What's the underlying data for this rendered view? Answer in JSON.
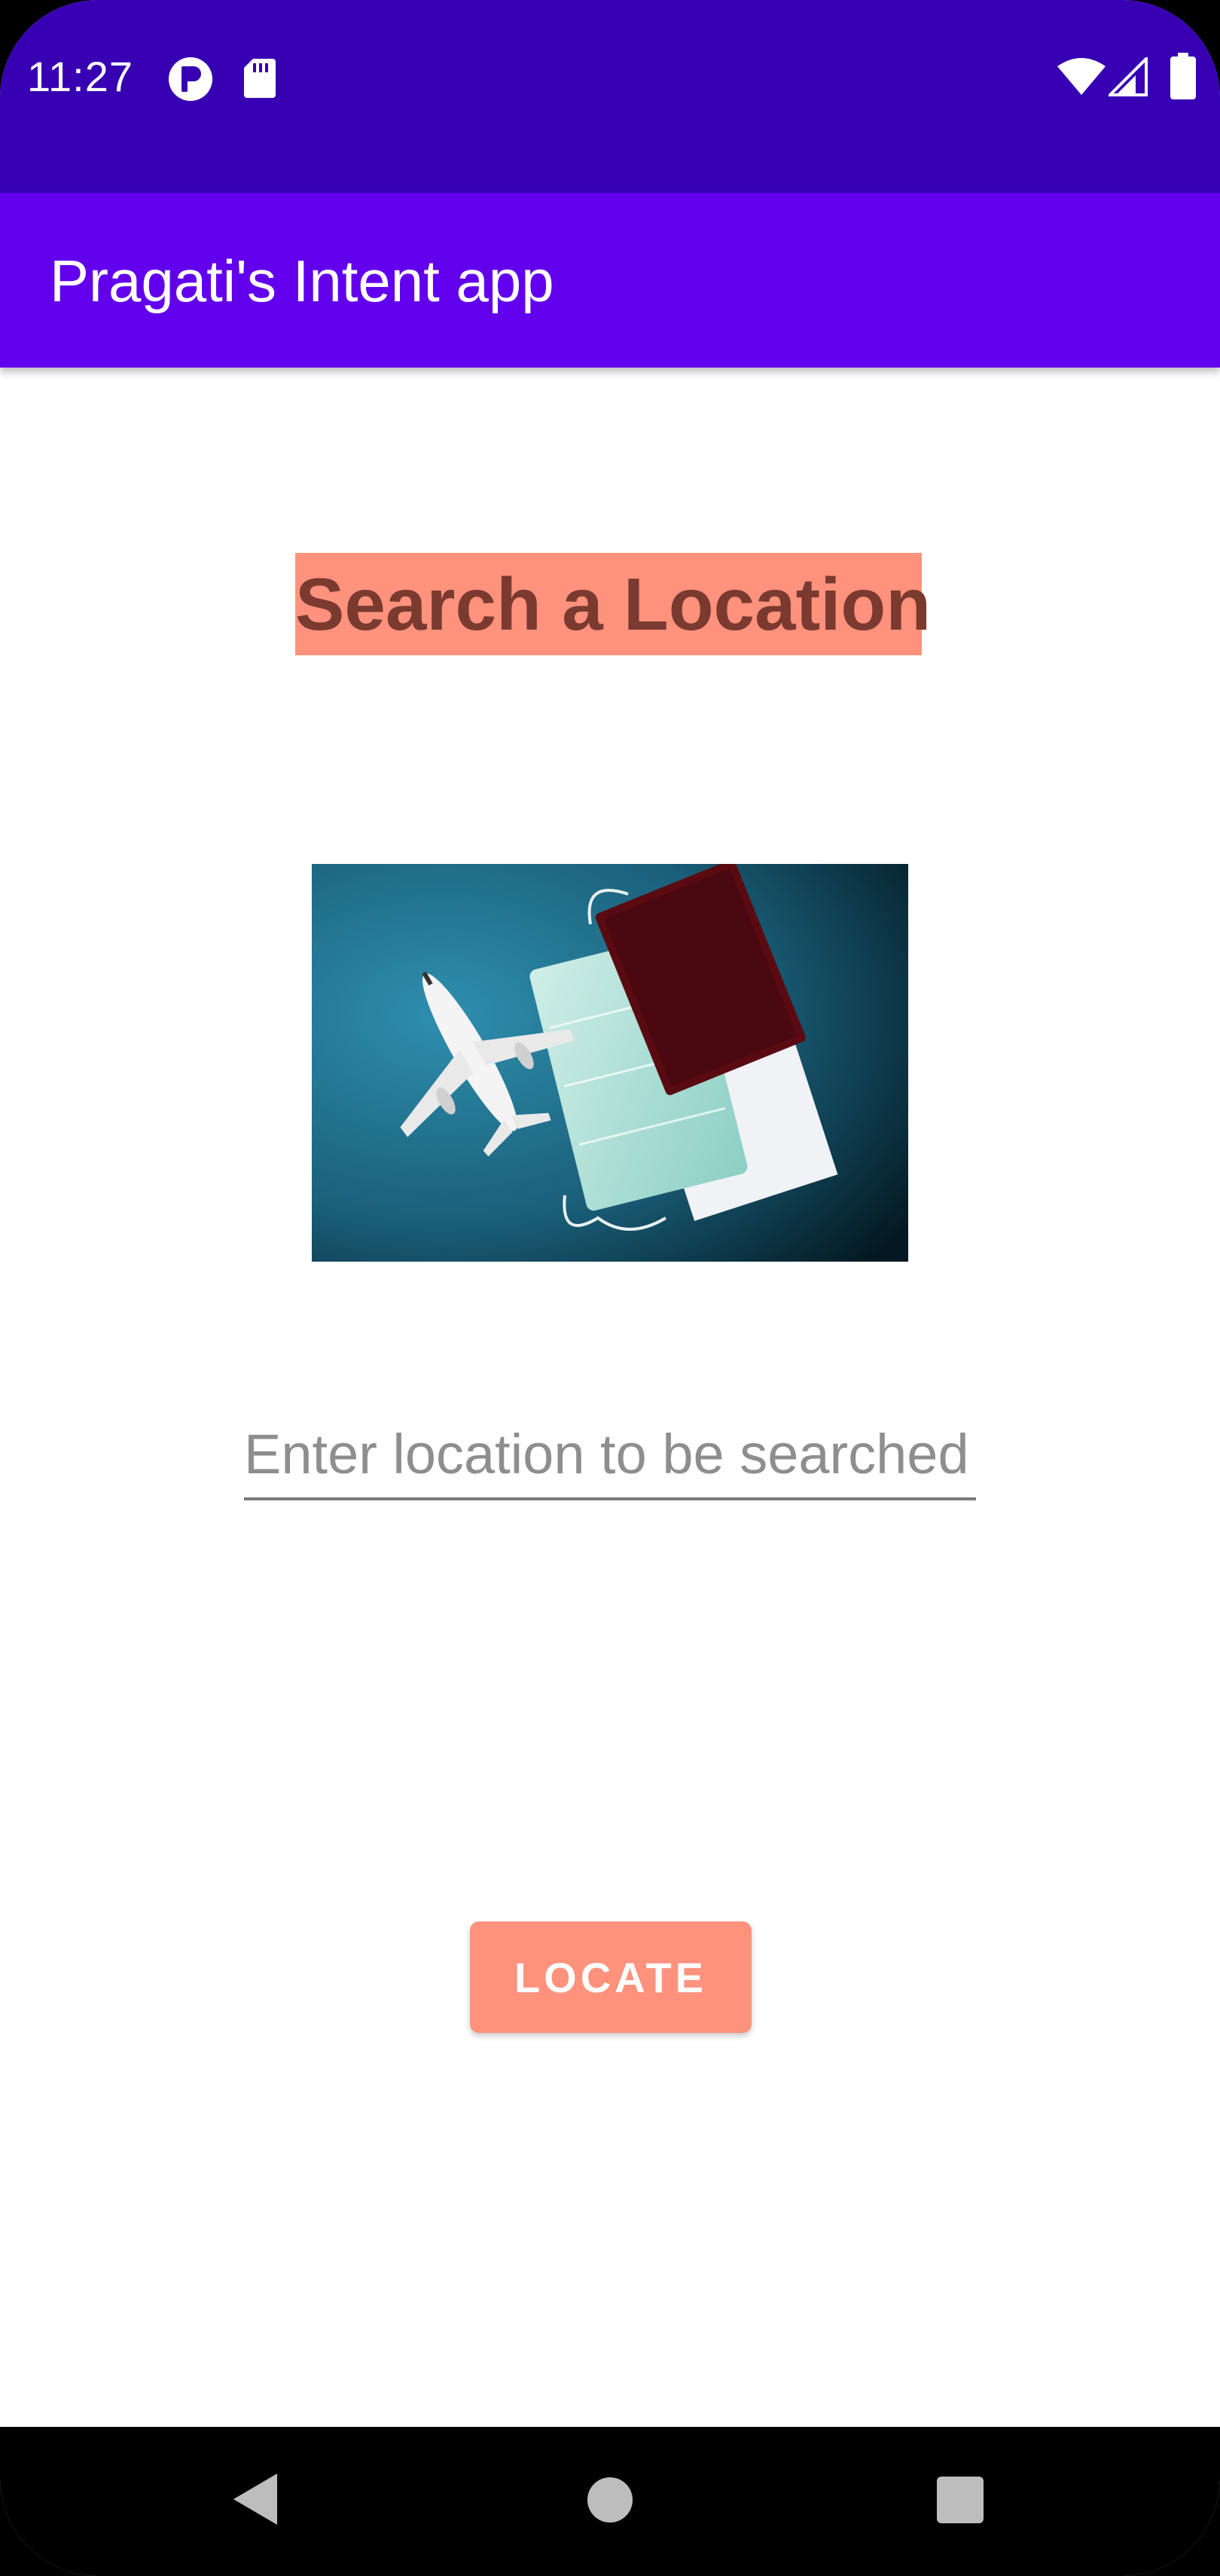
{
  "status_bar": {
    "time": "11:27",
    "background": "#3700b3",
    "icons": [
      "app-notification-icon",
      "sd-card-icon",
      "wifi-icon",
      "cell-signal-icon",
      "battery-icon"
    ]
  },
  "app_bar": {
    "title": "Pragati's Intent app",
    "background": "#6200ee"
  },
  "main": {
    "heading": "Search a Location",
    "heading_background": "#ff927c",
    "heading_color": "#7a3a30",
    "image": {
      "label": "airplane-passport-mask-photo"
    },
    "location_input": {
      "value": "",
      "placeholder": "Enter location to be searched"
    },
    "locate_button": {
      "label": "LOCATE",
      "background": "#ff927c"
    }
  },
  "nav_bar": {
    "buttons": [
      "back-icon",
      "home-icon",
      "recents-icon"
    ]
  }
}
